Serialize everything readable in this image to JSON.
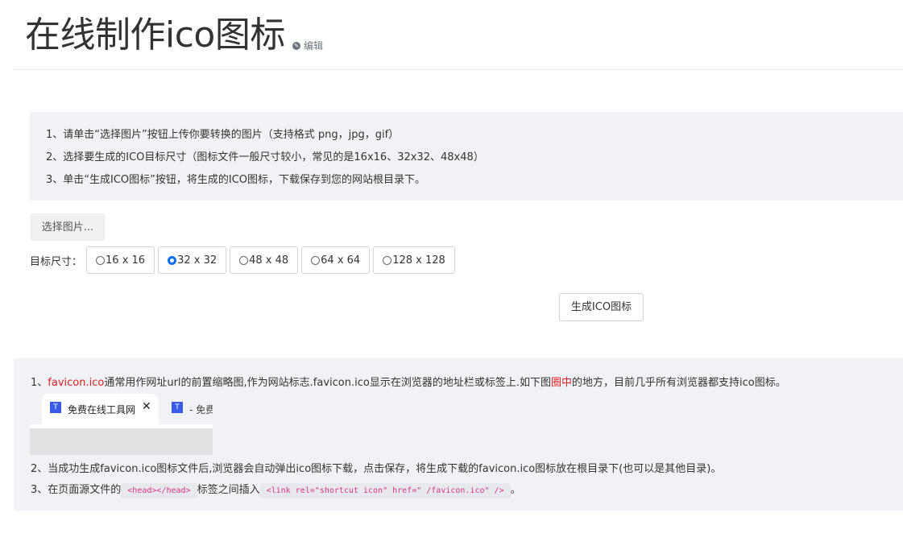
{
  "header": {
    "title": "在线制作ico图标",
    "edit_label": "编辑",
    "edit_icon": "✎"
  },
  "instructions": [
    "1、请单击“选择图片”按钮上传你要转换的图片（支持格式 png，jpg，gif）",
    "2、选择要生成的ICO目标尺寸（图标文件一般尺寸较小，常见的是16x16、32x32、48x48）",
    "3、单击“生成ICO图标”按钮，将生成的ICO图标，下载保存到您的网站根目录下。"
  ],
  "upload": {
    "button_label": "选择图片..."
  },
  "sizes": {
    "label": "目标尺寸：",
    "options": [
      {
        "label": "16 x 16",
        "checked": false
      },
      {
        "label": "32 x 32",
        "checked": true
      },
      {
        "label": "48 x 48",
        "checked": false
      },
      {
        "label": "64 x 64",
        "checked": false
      },
      {
        "label": "128 x 128",
        "checked": false
      }
    ]
  },
  "generate": {
    "button_label": "生成ICO图标"
  },
  "info": {
    "line1": {
      "prefix": "1、",
      "link": "favicon.ico",
      "text_a": "通常用作网址url的前置缩略图,作为网站标志.favicon.ico显示在浏览器的地址栏或标签上.如下图",
      "highlight": "圈中",
      "text_b": "的地方，目前几乎所有浏览器都支持ico图标。"
    },
    "browser_example": {
      "tab1_icon": "T",
      "tab1_title": "免费在线工具网",
      "tab1_close": "✕",
      "tab2_icon": "T",
      "tab2_title": "- 免费"
    },
    "line2": "2、当成功生成favicon.ico图标文件后,浏览器会自动弹出ico图标下载，点击保存，将生成下载的favicon.ico图标放在根目录下(也可以是其他目录)。",
    "line3": {
      "prefix": "3、在页面源文件的",
      "code1": "<head></head>",
      "middle": "标签之间插入",
      "code2": "<link rel=\"shortcut icon\" href=\" /favicon.ico\" />",
      "suffix": "。"
    }
  }
}
